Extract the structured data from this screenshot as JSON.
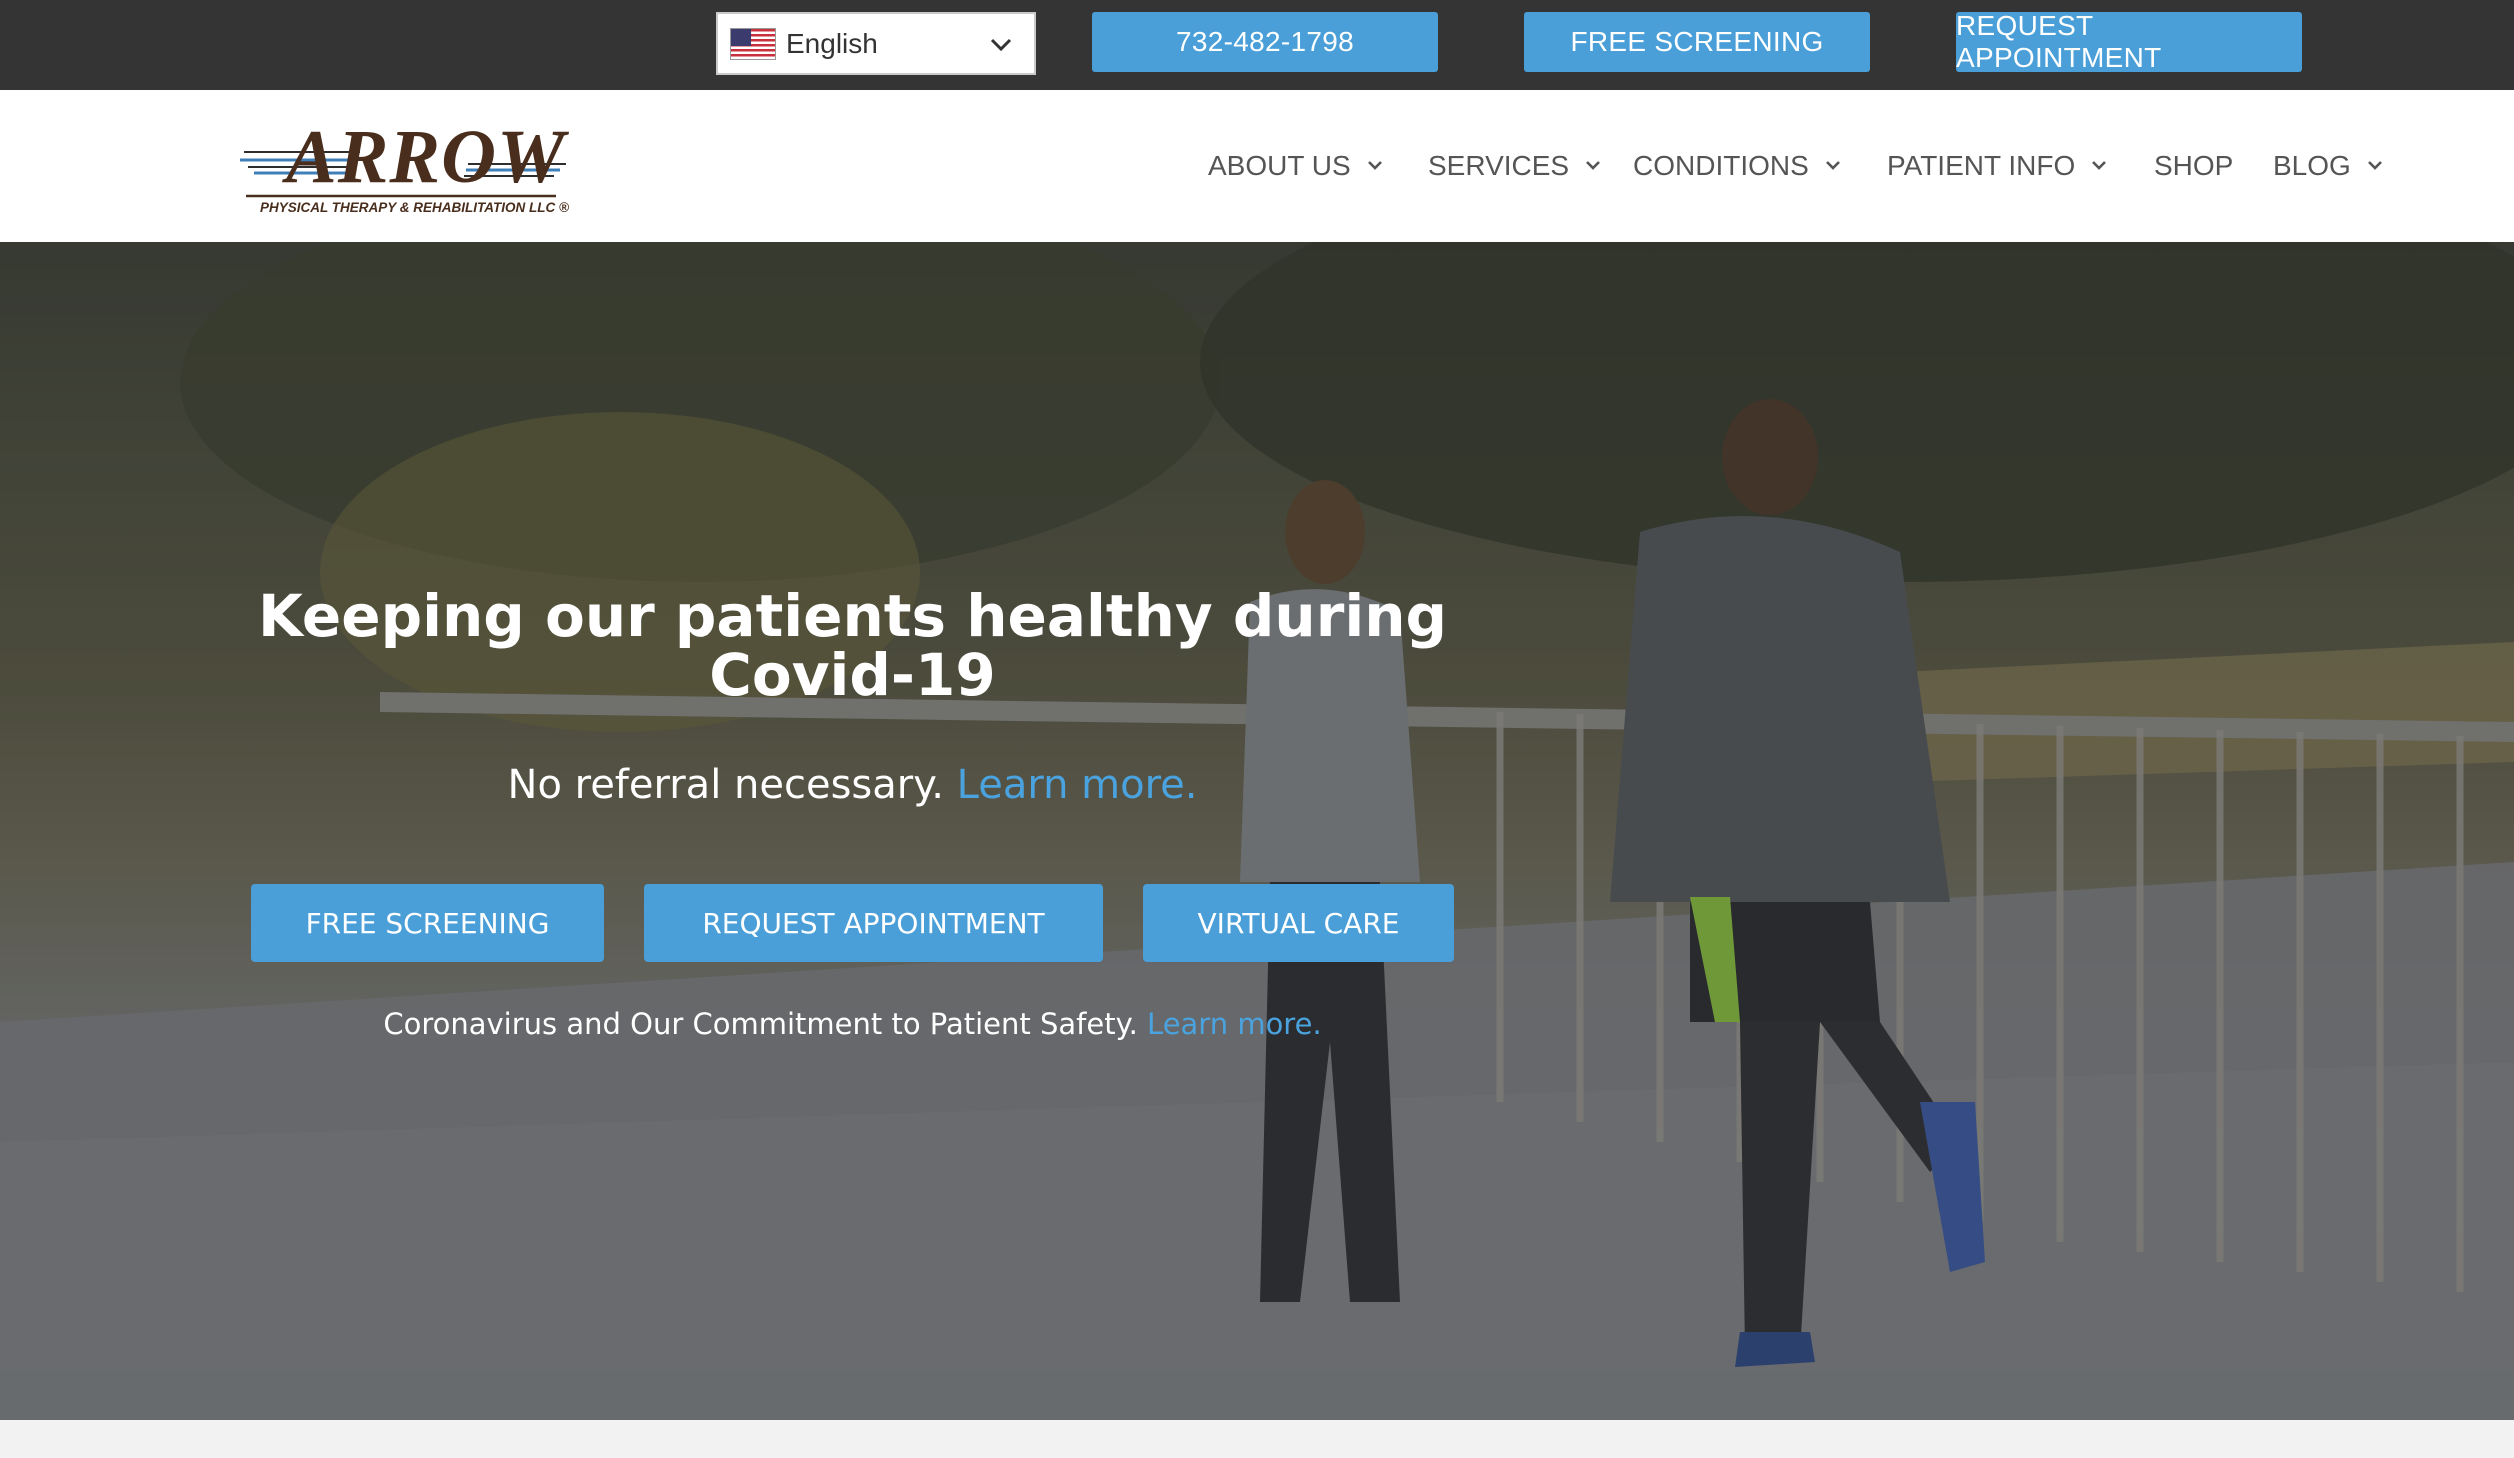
{
  "topbar": {
    "language": {
      "label": "English",
      "flag": "us-flag-icon"
    },
    "phone_label": "732-482-1798",
    "screening_label": "FREE SCREENING",
    "appointment_label": "REQUEST APPOINTMENT"
  },
  "header": {
    "logo": {
      "wordmark": "ARROW",
      "tagline": "PHYSICAL THERAPY & REHABILITATION LLC ®"
    },
    "nav": [
      {
        "label": "ABOUT US",
        "dropdown": true
      },
      {
        "label": "SERVICES",
        "dropdown": true
      },
      {
        "label": "CONDITIONS",
        "dropdown": true
      },
      {
        "label": "PATIENT INFO",
        "dropdown": true
      },
      {
        "label": "SHOP",
        "dropdown": false
      },
      {
        "label": "BLOG",
        "dropdown": true
      }
    ]
  },
  "hero": {
    "title": "Keeping our patients healthy during Covid-19",
    "subtitle_text": "No referral necessary.",
    "subtitle_link": "Learn more.",
    "buttons": [
      "FREE SCREENING",
      "REQUEST APPOINTMENT",
      "VIRTUAL CARE"
    ],
    "note_text": "Coronavirus and Our Commitment to Patient Safety.",
    "note_link": "Learn more."
  },
  "colors": {
    "topbar_bg": "#343434",
    "accent": "#4a9fd8",
    "link": "#4aa3de",
    "nav_text": "#555555",
    "logo_brown": "#4a2e1d"
  }
}
